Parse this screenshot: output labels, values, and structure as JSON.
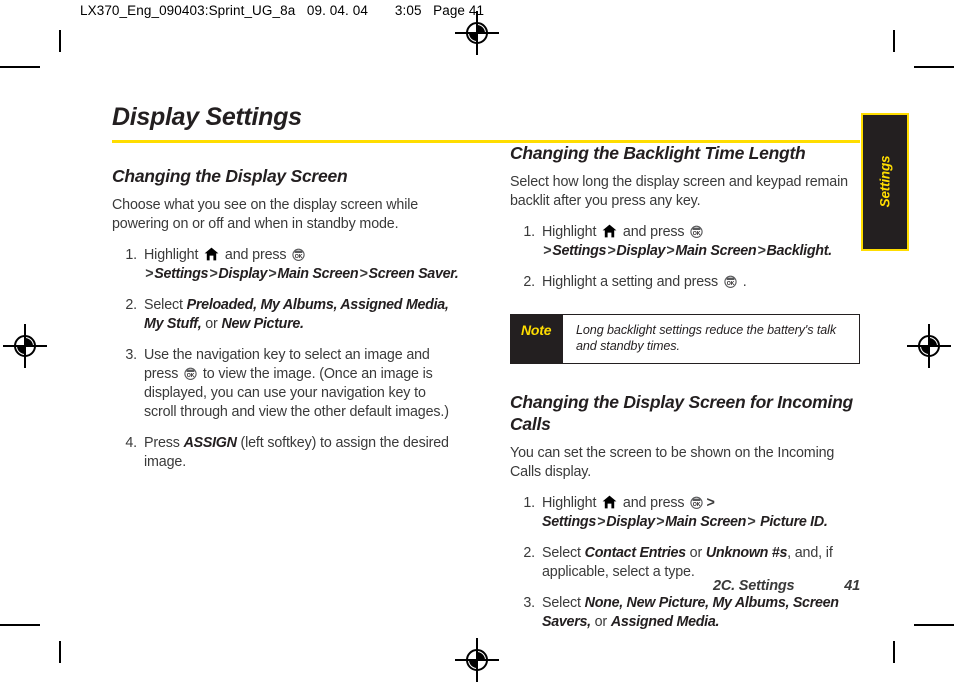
{
  "slug": "LX370_Eng_090403:Sprint_UG_8a   09. 04. 04       3:05   Page 41",
  "title": "Display Settings",
  "left_column": {
    "section_heading": "Changing the Display Screen",
    "intro": "Choose what you see on the display screen while powering on or off and when in standby mode.",
    "steps": [
      {
        "num": "1.",
        "parts": [
          {
            "type": "text",
            "text": "Highlight "
          },
          {
            "type": "icon",
            "icon": "home-key-icon"
          },
          {
            "type": "text",
            "text": " and press "
          },
          {
            "type": "icon",
            "icon": "ok-key-icon"
          },
          {
            "type": "gt",
            "text": ">"
          },
          {
            "type": "italic",
            "text": "Settings"
          },
          {
            "type": "gt",
            "text": ">"
          },
          {
            "type": "italic",
            "text": "Display"
          },
          {
            "type": "gt",
            "text": ">"
          },
          {
            "type": "italic",
            "text": "Main Screen"
          },
          {
            "type": "gt",
            "text": ">"
          },
          {
            "type": "italic",
            "text": "Screen Saver."
          }
        ]
      },
      {
        "num": "2.",
        "parts": [
          {
            "type": "text",
            "text": "Select "
          },
          {
            "type": "italic",
            "text": "Preloaded, My Albums, Assigned Media, My Stuff,"
          },
          {
            "type": "text",
            "text": " or "
          },
          {
            "type": "italic",
            "text": "New Picture."
          }
        ]
      },
      {
        "num": "3.",
        "parts": [
          {
            "type": "text",
            "text": "Use the navigation key to select an image and press "
          },
          {
            "type": "icon",
            "icon": "ok-key-icon"
          },
          {
            "type": "text",
            "text": " to view the image. (Once an image is displayed, you can use your navigation key to scroll through and view the other default images.)"
          }
        ]
      },
      {
        "num": "4.",
        "parts": [
          {
            "type": "text",
            "text": "Press "
          },
          {
            "type": "italic",
            "text": "ASSIGN"
          },
          {
            "type": "text",
            "text": "  (left softkey)  to assign the desired image."
          }
        ]
      }
    ]
  },
  "right_column": {
    "section_one": {
      "heading": "Changing the Backlight Time Length",
      "intro": "Select how long the display screen and keypad remain backlit after you press any key.",
      "steps": [
        {
          "num": "1.",
          "parts": [
            {
              "type": "text",
              "text": "Highlight "
            },
            {
              "type": "icon",
              "icon": "home-key-icon"
            },
            {
              "type": "text",
              "text": " and press "
            },
            {
              "type": "icon",
              "icon": "ok-key-icon"
            },
            {
              "type": "gt",
              "text": ">"
            },
            {
              "type": "italic",
              "text": "Settings"
            },
            {
              "type": "gt",
              "text": ">"
            },
            {
              "type": "italic",
              "text": "Display"
            },
            {
              "type": "gt",
              "text": ">"
            },
            {
              "type": "italic",
              "text": "Main Screen"
            },
            {
              "type": "gt",
              "text": ">"
            },
            {
              "type": "italic",
              "text": "Backlight."
            }
          ]
        },
        {
          "num": "2.",
          "parts": [
            {
              "type": "text",
              "text": "Highlight a setting and press "
            },
            {
              "type": "icon",
              "icon": "ok-key-icon"
            },
            {
              "type": "text",
              "text": " ."
            }
          ]
        }
      ]
    },
    "note": {
      "label": "Note",
      "text": "Long backlight settings reduce the battery's talk and standby times."
    },
    "section_two": {
      "heading": "Changing the Display Screen for Incoming Calls",
      "intro": "You can set the screen to be shown on the Incoming Calls display.",
      "steps": [
        {
          "num": "1.",
          "parts": [
            {
              "type": "text",
              "text": "Highlight "
            },
            {
              "type": "icon",
              "icon": "home-key-icon"
            },
            {
              "type": "text",
              "text": " and press "
            },
            {
              "type": "icon",
              "icon": "ok-key-icon"
            },
            {
              "type": "gt",
              "text": "> "
            },
            {
              "type": "italic",
              "text": "Settings"
            },
            {
              "type": "gt",
              "text": ">"
            },
            {
              "type": "italic",
              "text": "Display"
            },
            {
              "type": "gt",
              "text": ">"
            },
            {
              "type": "italic",
              "text": "Main Screen"
            },
            {
              "type": "gt",
              "text": "> "
            },
            {
              "type": "italic",
              "text": "Picture ID."
            }
          ]
        },
        {
          "num": "2.",
          "parts": [
            {
              "type": "text",
              "text": "Select "
            },
            {
              "type": "italic",
              "text": "Contact Entries"
            },
            {
              "type": "text",
              "text": " or "
            },
            {
              "type": "italic",
              "text": "Unknown #s"
            },
            {
              "type": "text",
              "text": ", and, if applicable, select a type."
            }
          ]
        },
        {
          "num": "3.",
          "parts": [
            {
              "type": "text",
              "text": "Select "
            },
            {
              "type": "italic",
              "text": "None, New Picture, My Albums, Screen Savers,"
            },
            {
              "type": "text",
              "text": " or "
            },
            {
              "type": "italic",
              "text": "Assigned Media."
            }
          ]
        }
      ]
    }
  },
  "side_tab": "Settings",
  "footer": {
    "chapter": "2C. Settings",
    "page_number": "41"
  },
  "colors": {
    "accent_yellow": "#ffdd00",
    "ink": "#231f20",
    "body_text": "#3a3a3a"
  }
}
